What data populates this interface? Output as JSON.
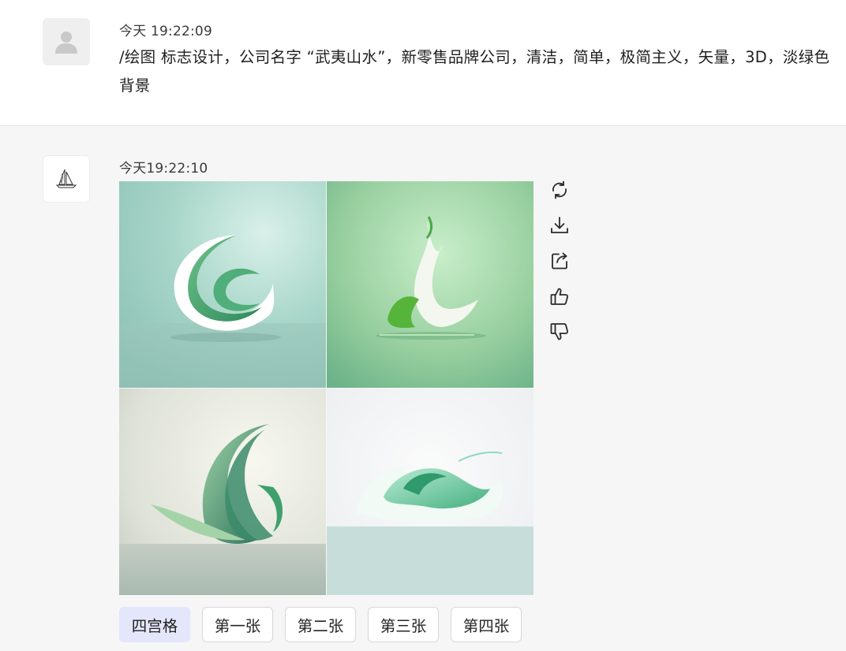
{
  "user_message": {
    "timestamp": "今天 19:22:09",
    "text": "/绘图 标志设计，公司名字 “武夷山水”，新零售品牌公司，清洁，简单，极简主义，矢量，3D，淡绿色背景",
    "avatar_icon": "user-silhouette-icon"
  },
  "bot_message": {
    "timestamp": "今天19:22:10",
    "avatar_icon": "sailboat-logo-icon",
    "image_grid": {
      "description_icons": [
        "crescent-swirl-logo",
        "leaf-flame-logo",
        "curved-leaf-logo",
        "wave-logo"
      ]
    },
    "actions": [
      {
        "name": "regenerate",
        "icon": "refresh-icon"
      },
      {
        "name": "download",
        "icon": "download-icon"
      },
      {
        "name": "share",
        "icon": "share-icon"
      },
      {
        "name": "like",
        "icon": "thumbs-up-icon"
      },
      {
        "name": "dislike",
        "icon": "thumbs-down-icon"
      }
    ],
    "buttons": [
      {
        "label": "四宫格",
        "active": true
      },
      {
        "label": "第一张",
        "active": false
      },
      {
        "label": "第二张",
        "active": false
      },
      {
        "label": "第三张",
        "active": false
      },
      {
        "label": "第四张",
        "active": false
      }
    ]
  },
  "colors": {
    "accent_button": "#e4e7fb",
    "background": "#f6f6f6",
    "user_block": "#ffffff"
  }
}
